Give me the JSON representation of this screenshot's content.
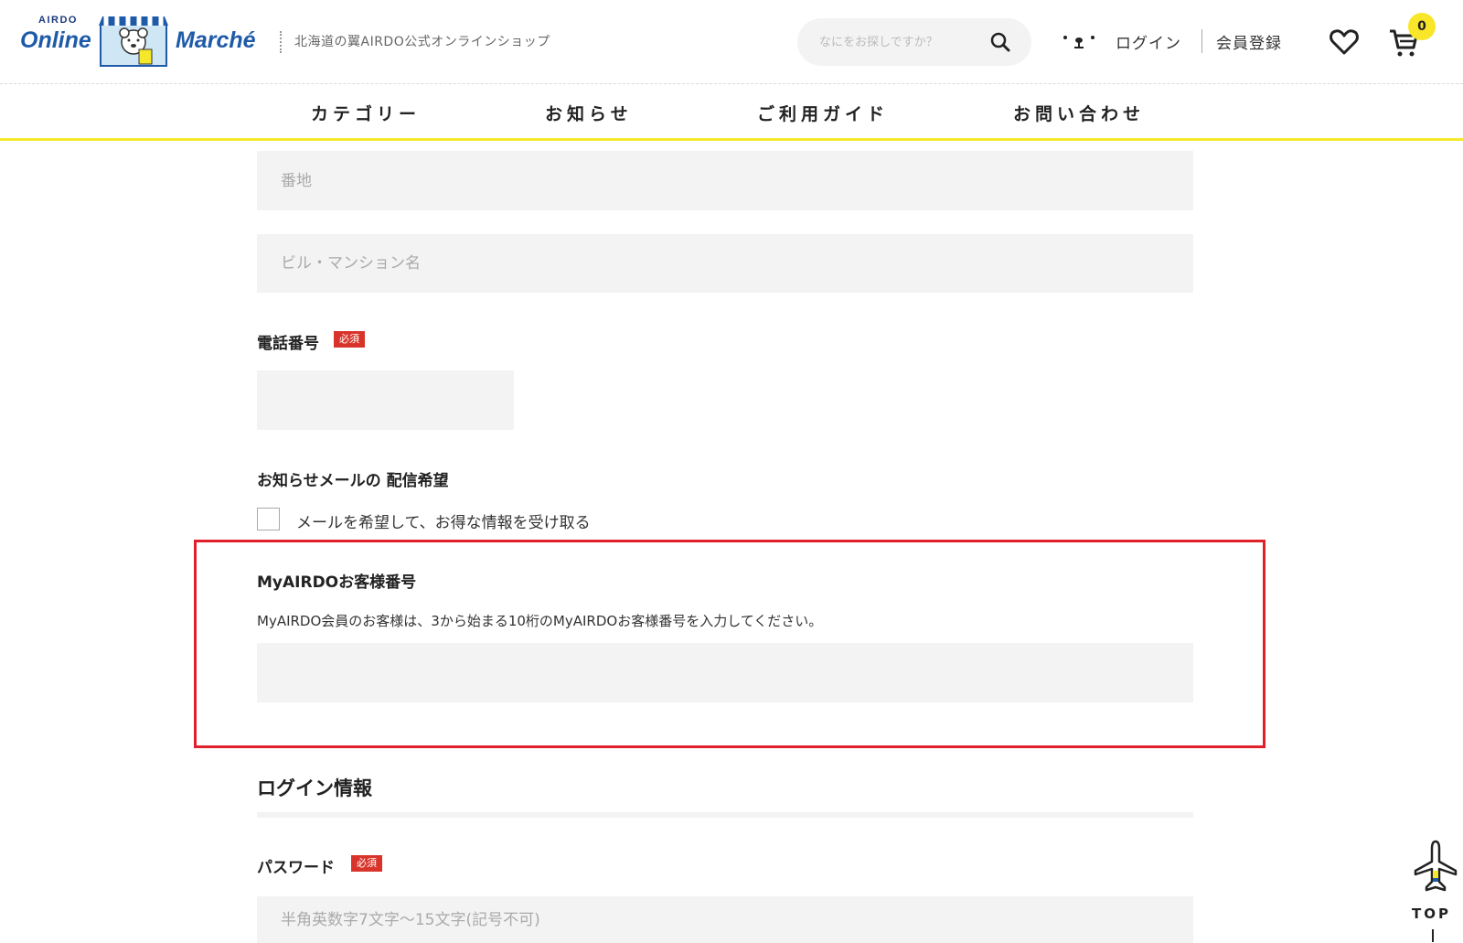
{
  "header": {
    "brand_small": "AIRDO",
    "brand_online": "Online",
    "brand_marche": "Marché",
    "tagline": "北海道の翼AIRDO公式オンラインショップ",
    "search_placeholder": "なにをお探しですか？",
    "login_label": "ログイン",
    "register_label": "会員登録",
    "cart_count": "0"
  },
  "nav": {
    "items": [
      {
        "label": "カテゴリー"
      },
      {
        "label": "お知らせ"
      },
      {
        "label": "ご利用ガイド"
      },
      {
        "label": "お問い合わせ"
      }
    ]
  },
  "form": {
    "address_street_placeholder": "番地",
    "building_placeholder": "ビル・マンション名",
    "phone_label": "電話番号",
    "required_badge": "必須",
    "newsletter_label": "お知らせメールの 配信希望",
    "newsletter_checkbox_label": "メールを希望して、お得な情報を受け取る",
    "myairdo_label": "MyAIRDOお客様番号",
    "myairdo_desc": "MyAIRDO会員のお客様は、3から始まる10桁のMyAIRDOお客様番号を入力してください。",
    "login_section_title": "ログイン情報",
    "password_label": "パスワード",
    "password_placeholder": "半角英数字7文字～15文字(記号不可)"
  },
  "top_button": {
    "label": "TOP"
  },
  "colors": {
    "accent_yellow": "#f5e82a",
    "required_red": "#d9342b",
    "highlight_red": "#e0202b",
    "brand_blue": "#1f5aa8"
  }
}
